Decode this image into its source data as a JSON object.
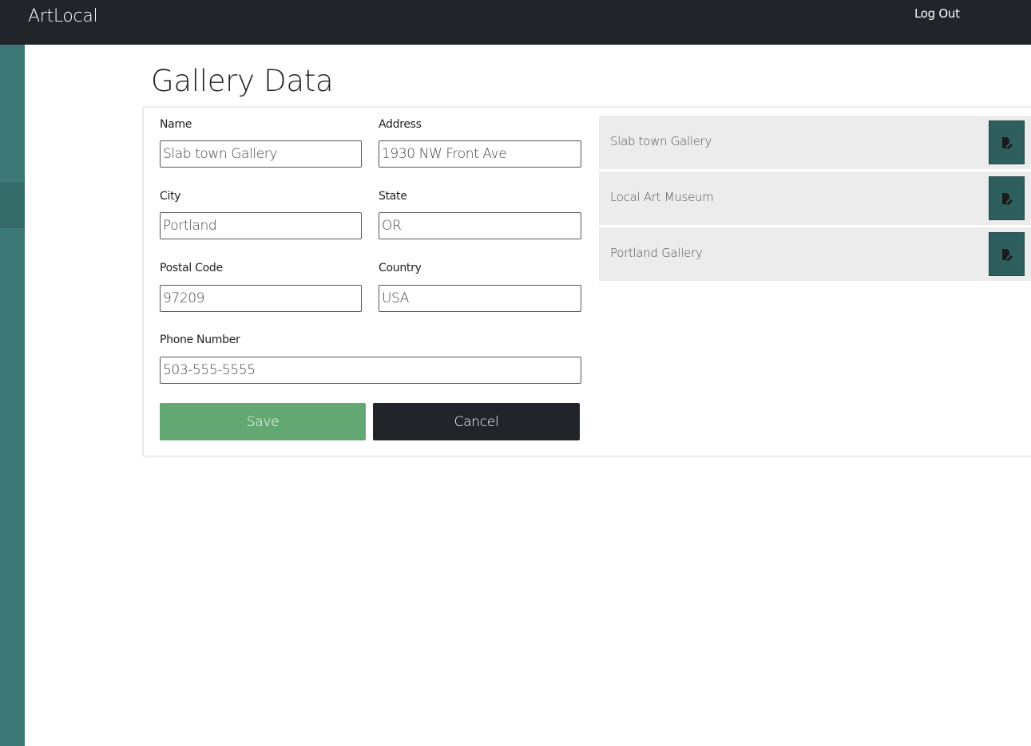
{
  "header": {
    "brand": "ArtLocal",
    "logout_label": "Log Out"
  },
  "main": {
    "title": "Gallery Data"
  },
  "form": {
    "name": {
      "label": "Name",
      "value": "Slab town Gallery"
    },
    "address": {
      "label": "Address",
      "value": "1930 NW Front Ave"
    },
    "city": {
      "label": "City",
      "value": "Portland"
    },
    "state": {
      "label": "State",
      "value": "OR"
    },
    "postal_code": {
      "label": "Postal Code",
      "value": "97209"
    },
    "country": {
      "label": "Country",
      "value": "USA"
    },
    "phone": {
      "label": "Phone Number",
      "value": "503-555-5555"
    },
    "save_label": "Save",
    "cancel_label": "Cancel"
  },
  "galleries": [
    {
      "name": "Slab town Gallery",
      "icon": "edit-icon"
    },
    {
      "name": "Local Art Museum",
      "icon": "edit-icon"
    },
    {
      "name": "Portland Gallery",
      "icon": "edit-icon"
    }
  ],
  "colors": {
    "topbar": "#212529",
    "sidebar": "#3a7775",
    "save": "#63a872",
    "cancel": "#212529",
    "edit_button": "#2f5e5e",
    "list_item": "#ececec"
  }
}
